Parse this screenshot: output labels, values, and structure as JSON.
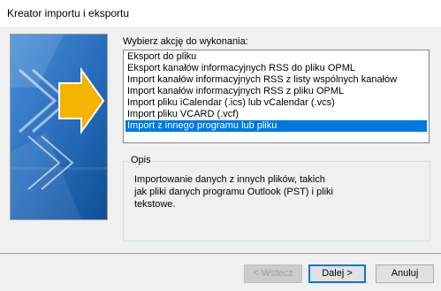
{
  "window": {
    "title": "Kreator importu i eksportu"
  },
  "action": {
    "prompt": "Wybierz akcję do wykonania:",
    "options": [
      "Eksport do pliku",
      "Eksport kanałów informacyjnych RSS do pliku OPML",
      "Import kanałów informacyjnych RSS z listy wspólnych kanałów",
      "Import kanałów informacyjnych RSS z pliku OPML",
      "Import pliku iCalendar (.ics) lub vCalendar (.vcs)",
      "Import pliku VCARD (.vcf)",
      "Import z innego programu lub pliku"
    ],
    "selected_index": 6
  },
  "description": {
    "legend": "Opis",
    "text_lines": [
      "Importowanie danych z innych plików, takich",
      "jak pliki danych programu Outlook (PST) i pliki",
      "tekstowe."
    ]
  },
  "buttons": {
    "back_label": "< Wstecz",
    "next_label": "Dalej >",
    "cancel_label": "Anuluj"
  },
  "colors": {
    "selection": "#0078d7",
    "art_background": "#1a5fa8"
  }
}
